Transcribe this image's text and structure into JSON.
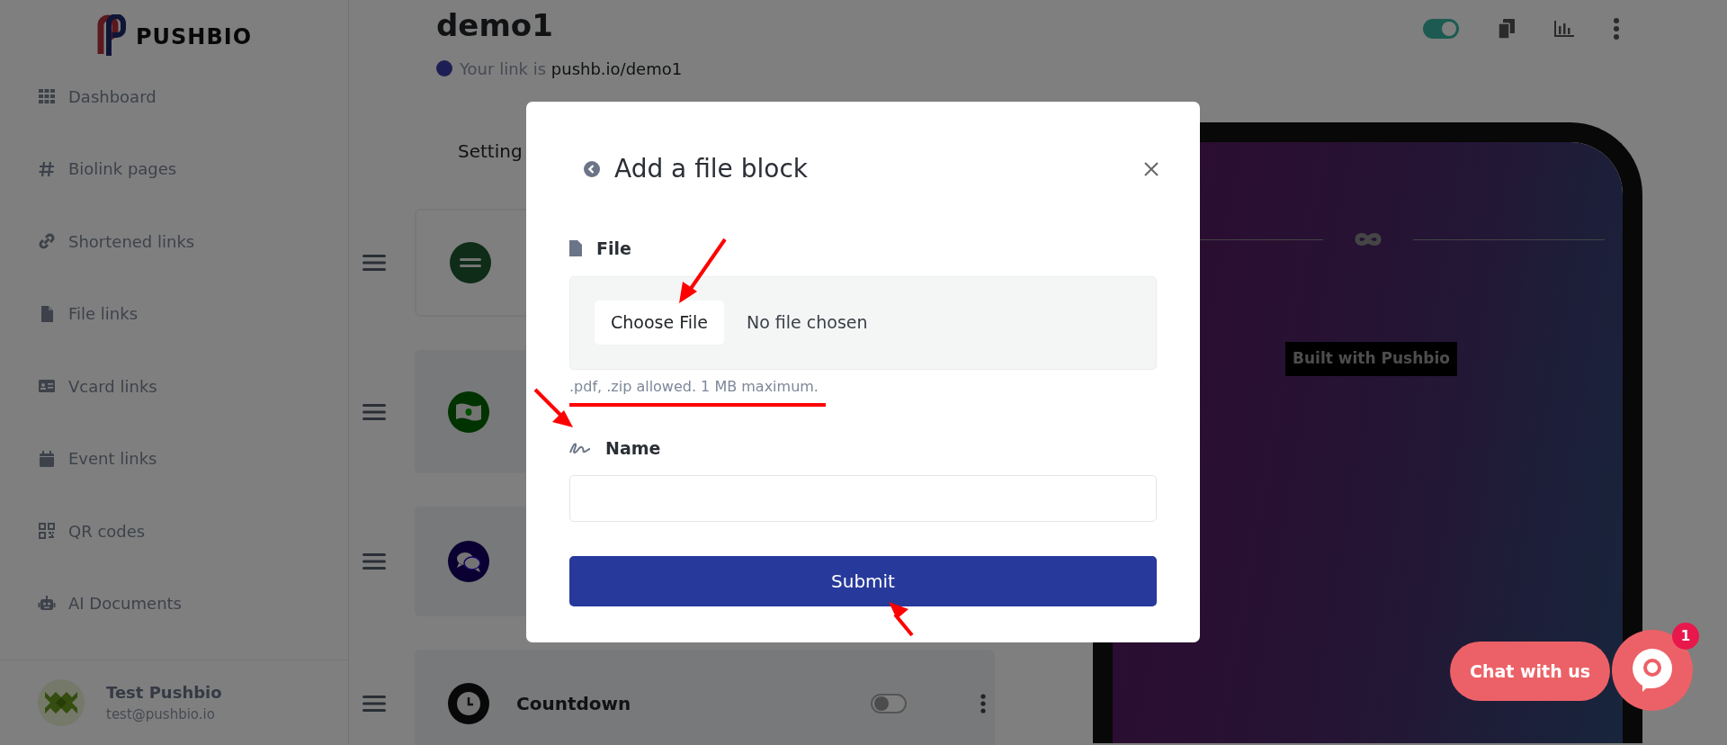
{
  "logo": {
    "text": "PUSHBIO"
  },
  "sidebar": {
    "items": [
      {
        "label": "Dashboard"
      },
      {
        "label": "Biolink pages"
      },
      {
        "label": "Shortened links"
      },
      {
        "label": "File links"
      },
      {
        "label": "Vcard links"
      },
      {
        "label": "Event links"
      },
      {
        "label": "QR codes"
      },
      {
        "label": "AI Documents"
      }
    ]
  },
  "user": {
    "name": "Test Pushbio",
    "email": "test@pushbio.io"
  },
  "header": {
    "title": "demo1",
    "link_prefix": "Your link is",
    "link": "pushb.io/demo1",
    "enabled": true
  },
  "settings_tab": {
    "label": "Setting"
  },
  "blocks": [
    {
      "kind": "link"
    },
    {
      "kind": "payment"
    },
    {
      "kind": "chat"
    },
    {
      "kind": "countdown",
      "label": "Countdown",
      "enabled": false
    }
  ],
  "preview": {
    "badge": "Built with Pushbio"
  },
  "modal": {
    "title": "Add a file block",
    "file_label": "File",
    "file_button": "Choose File",
    "file_status": "No file chosen",
    "file_hint": ".pdf, .zip allowed. 1 MB maximum.",
    "name_label": "Name",
    "submit": "Submit"
  },
  "chat": {
    "label": "Chat with us",
    "badge": "1"
  }
}
